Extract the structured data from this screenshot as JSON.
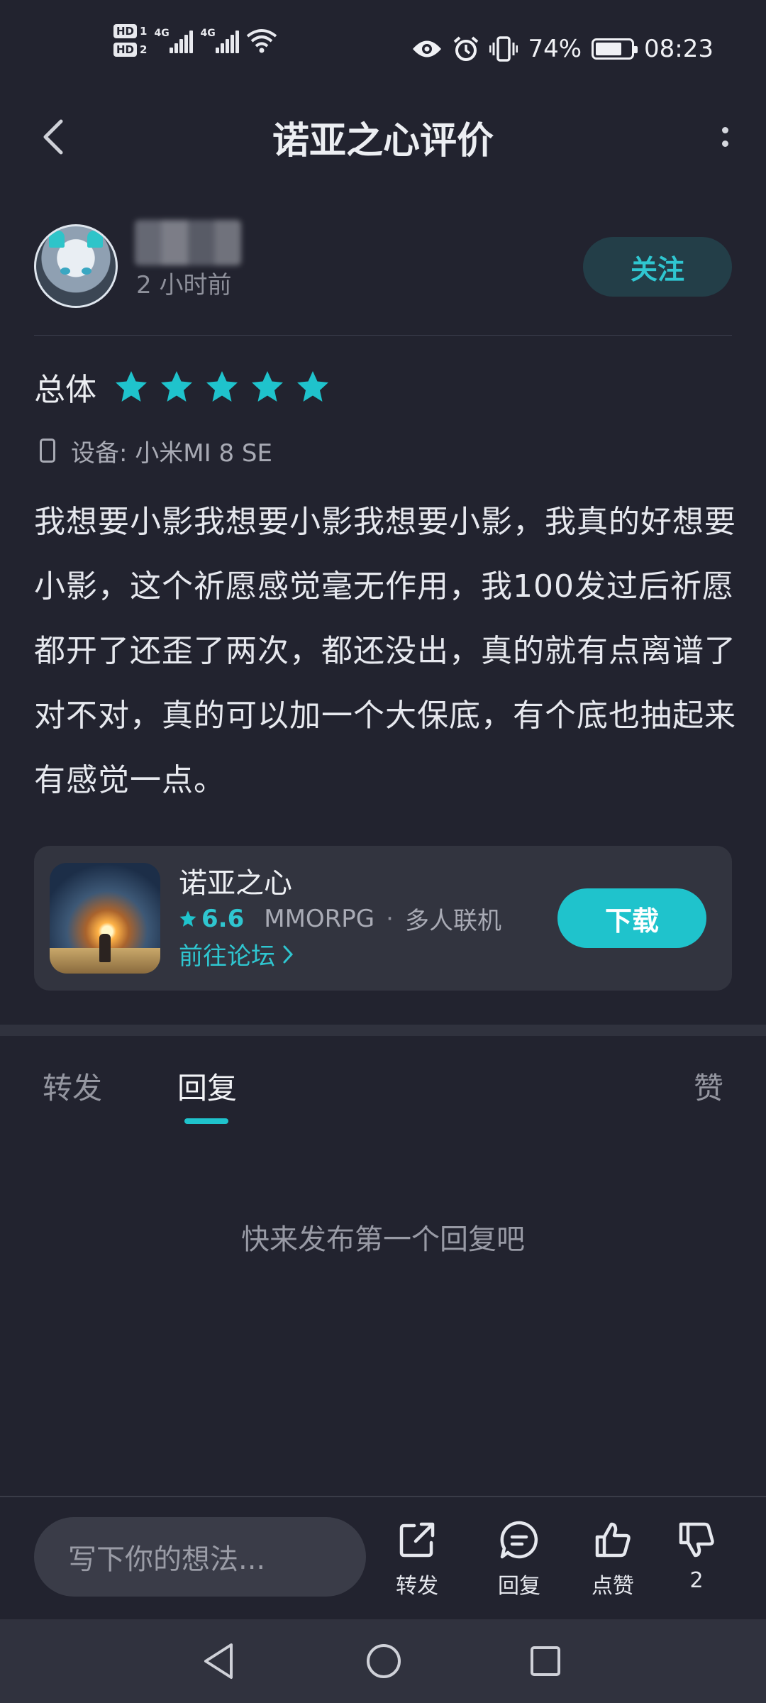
{
  "status_bar": {
    "sim1": "HD",
    "sim1_num": "1",
    "sim2": "HD",
    "sim2_num": "2",
    "network1": "4G",
    "network2": "4G",
    "battery_percent": "74%",
    "battery_level": 0.74,
    "time": "08:23",
    "icons": [
      "eye-icon",
      "alarm-icon",
      "vibrate-icon",
      "wifi-icon"
    ]
  },
  "header": {
    "title": "诺亚之心评价"
  },
  "post": {
    "time_ago": "2 小时前",
    "follow_label": "关注",
    "rating_label": "总体",
    "stars": 5,
    "device_label": "设备:",
    "device_value": "小米MI 8 SE",
    "body": "我想要小影我想要小影我想要小影，我真的好想要小影，这个祈愿感觉毫无作用，我100发过后祈愿都开了还歪了两次，都还没出，真的就有点离谱了对不对，真的可以加一个大保底，有个底也抽起来有感觉一点。"
  },
  "game_card": {
    "name": "诺亚之心",
    "score": "6.6",
    "genre": "MMORPG",
    "separator": "·",
    "tag": "多人联机",
    "forum_link": "前往论坛",
    "download_label": "下载"
  },
  "tabs": [
    {
      "label": "转发"
    },
    {
      "label": "回复"
    },
    {
      "label": "赞"
    }
  ],
  "active_tab": "回复",
  "empty_state": "快来发布第一个回复吧",
  "action_bar": {
    "input_placeholder": "写下你的想法...",
    "share_label": "转发",
    "reply_label": "回复",
    "like_label": "点赞",
    "dislike_count": "2"
  },
  "colors": {
    "background": "#22232f",
    "accent": "#1fc3cc",
    "card": "#32343f"
  }
}
